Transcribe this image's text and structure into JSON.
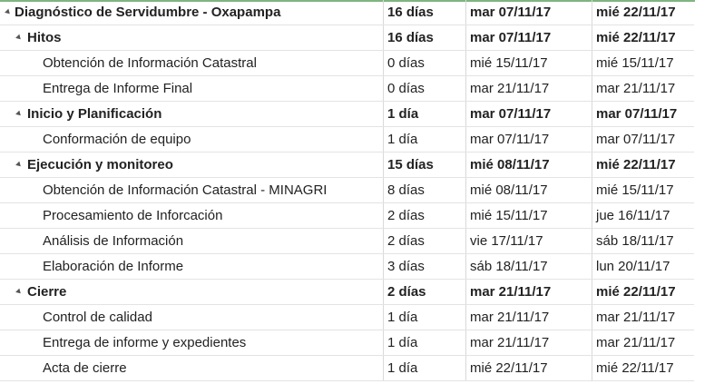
{
  "rows": [
    {
      "name": "Diagnóstico de Servidumbre - Oxapampa",
      "duration": "16 días",
      "start": "mar 07/11/17",
      "end": "mié 22/11/17",
      "level": 0,
      "summary": true
    },
    {
      "name": "Hitos",
      "duration": "16 días",
      "start": "mar 07/11/17",
      "end": "mié 22/11/17",
      "level": 1,
      "summary": true
    },
    {
      "name": "Obtención de Información Catastral",
      "duration": "0 días",
      "start": "mié 15/11/17",
      "end": "mié 15/11/17",
      "level": 2,
      "summary": false
    },
    {
      "name": "Entrega de Informe Final",
      "duration": "0 días",
      "start": "mar 21/11/17",
      "end": "mar 21/11/17",
      "level": 2,
      "summary": false
    },
    {
      "name": "Inicio y Planificación",
      "duration": "1 día",
      "start": "mar 07/11/17",
      "end": "mar 07/11/17",
      "level": 1,
      "summary": true
    },
    {
      "name": "Conformación de equipo",
      "duration": "1 día",
      "start": "mar 07/11/17",
      "end": "mar 07/11/17",
      "level": 2,
      "summary": false
    },
    {
      "name": "Ejecución y monitoreo",
      "duration": "15 días",
      "start": "mié 08/11/17",
      "end": "mié 22/11/17",
      "level": 1,
      "summary": true
    },
    {
      "name": "Obtención de Información Catastral - MINAGRI",
      "duration": "8 días",
      "start": "mié 08/11/17",
      "end": "mié 15/11/17",
      "level": 2,
      "summary": false
    },
    {
      "name": "Procesamiento de Inforcación",
      "duration": "2 días",
      "start": "mié 15/11/17",
      "end": "jue 16/11/17",
      "level": 2,
      "summary": false
    },
    {
      "name": "Análisis de Información",
      "duration": "2 días",
      "start": "vie 17/11/17",
      "end": "sáb 18/11/17",
      "level": 2,
      "summary": false
    },
    {
      "name": "Elaboración de Informe",
      "duration": "3 días",
      "start": "sáb 18/11/17",
      "end": "lun 20/11/17",
      "level": 2,
      "summary": false
    },
    {
      "name": "Cierre",
      "duration": "2 días",
      "start": "mar 21/11/17",
      "end": "mié 22/11/17",
      "level": 1,
      "summary": true
    },
    {
      "name": "Control de calidad",
      "duration": "1 día",
      "start": "mar 21/11/17",
      "end": "mar 21/11/17",
      "level": 2,
      "summary": false
    },
    {
      "name": "Entrega de informe y expedientes",
      "duration": "1 día",
      "start": "mar 21/11/17",
      "end": "mar 21/11/17",
      "level": 2,
      "summary": false
    },
    {
      "name": "Acta de cierre",
      "duration": "1 día",
      "start": "mié 22/11/17",
      "end": "mié 22/11/17",
      "level": 2,
      "summary": false
    }
  ],
  "colors": {
    "accent": "#7fb57f",
    "grid": "#d9d9d9"
  }
}
